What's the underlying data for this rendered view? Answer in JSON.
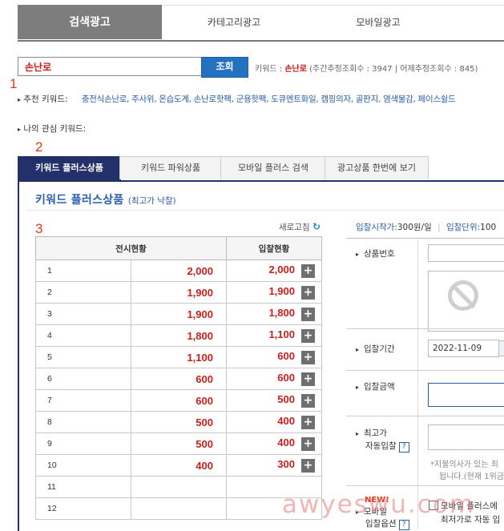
{
  "top_tabs": [
    "검색광고",
    "카테고리광고",
    "모바일광고"
  ],
  "search": {
    "value": "손난로",
    "button": "조회"
  },
  "keyword_info": {
    "prefix": "키워드 : ",
    "keyword": "손난로",
    "stats": "(주간추정조회수 : 3947 | 어제추정조회수 : 845)"
  },
  "annotations": [
    "1",
    "2",
    "3"
  ],
  "recommended": {
    "label": "추천 키워드:",
    "links": "충전식손난로, 주사위, 온습도계, 손난로핫팩, 군용핫팩, 도큐멘트화일, 캠핑의자, 골판지, 염색물감, 페이스쉴드"
  },
  "interest_label": "나의 관심 키워드:",
  "sub_tabs": [
    "키워드 플러스상품",
    "키워드 파워상품",
    "모바일 플러스 검색",
    "광고상품 한번에 보기"
  ],
  "panel": {
    "title": "키워드 플러스상품",
    "subtitle": "(최고가 낙찰)",
    "refresh": "새로고침"
  },
  "table": {
    "headers": [
      "전시현황",
      "입찰현황"
    ],
    "rows": [
      {
        "rank": "1",
        "display": "2,000",
        "bid": "2,000"
      },
      {
        "rank": "2",
        "display": "1,900",
        "bid": "1,900"
      },
      {
        "rank": "3",
        "display": "1,900",
        "bid": "1,800"
      },
      {
        "rank": "4",
        "display": "1,800",
        "bid": "1,100"
      },
      {
        "rank": "5",
        "display": "1,100",
        "bid": "600"
      },
      {
        "rank": "6",
        "display": "600",
        "bid": "600"
      },
      {
        "rank": "7",
        "display": "600",
        "bid": "500"
      },
      {
        "rank": "8",
        "display": "500",
        "bid": "400"
      },
      {
        "rank": "9",
        "display": "500",
        "bid": "400"
      },
      {
        "rank": "10",
        "display": "400",
        "bid": "300"
      },
      {
        "rank": "11",
        "display": "",
        "bid": ""
      },
      {
        "rank": "12",
        "display": "",
        "bid": ""
      }
    ]
  },
  "right_info": {
    "start_label": "입찰시작가:",
    "start_value": "300원/일",
    "unit_label": "입찰단위:",
    "unit_value": "100"
  },
  "form": {
    "product_no": "상품번호",
    "period": "입찰기간",
    "period_value": "2022-11-09",
    "amount": "입찰금액",
    "max_auto_1": "최고가",
    "max_auto_2": "자동입찰",
    "note_1": "*지불의사가 있는 최",
    "note_2": "됩니다.(현재 1위금",
    "new_badge": "NEW!",
    "mobile_1": "모바일",
    "mobile_2": "입찰옵션",
    "mobile_check": "모바일 플러스에",
    "mobile_note": "최저가로 자동 입"
  },
  "watermark": "awyeswu.com",
  "colors": {
    "accent_blue": "#2471c0",
    "navy": "#24306a",
    "red": "#c8201e",
    "tab_gray": "#7d7d7d"
  }
}
